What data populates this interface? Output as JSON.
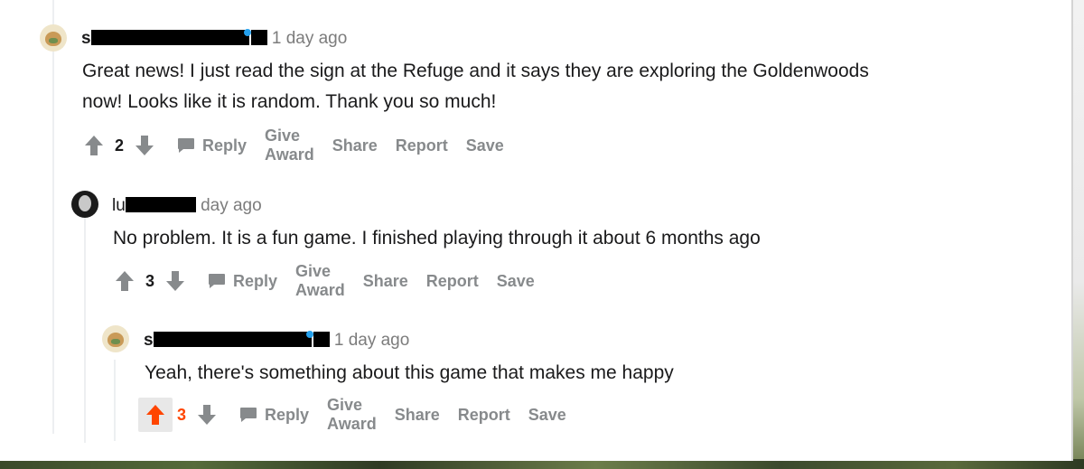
{
  "comments": [
    {
      "username_visible": "s",
      "time": "1 day ago",
      "body": [
        "Great news! I just read the sign at the Refuge and it says they are exploring the Goldenwoods",
        "now! Looks like it is random. Thank you so much!"
      ],
      "score": "2",
      "upvoted": false
    },
    {
      "username_visible": "lu",
      "time": "day ago",
      "body": [
        "No problem. It is a fun game. I finished playing through it about 6 months ago"
      ],
      "score": "3",
      "upvoted": false
    },
    {
      "username_visible": "s",
      "time": "1 day ago",
      "body": [
        "Yeah, there's something about this game that makes me happy"
      ],
      "score": "3",
      "upvoted": true
    }
  ],
  "actions": {
    "reply": "Reply",
    "give_award": "Give Award",
    "share": "Share",
    "report": "Report",
    "save": "Save"
  },
  "icons": {
    "upvote": "upvote-arrow-icon",
    "downvote": "downvote-arrow-icon",
    "reply": "chat-bubble-icon",
    "avatar1": "cat-avatar-icon",
    "avatar2": "portrait-avatar-icon"
  },
  "colors": {
    "upvote_active": "#ff4500",
    "meta_text": "#7c7c7c",
    "action_text": "#878a8c",
    "redaction": "#000000"
  }
}
